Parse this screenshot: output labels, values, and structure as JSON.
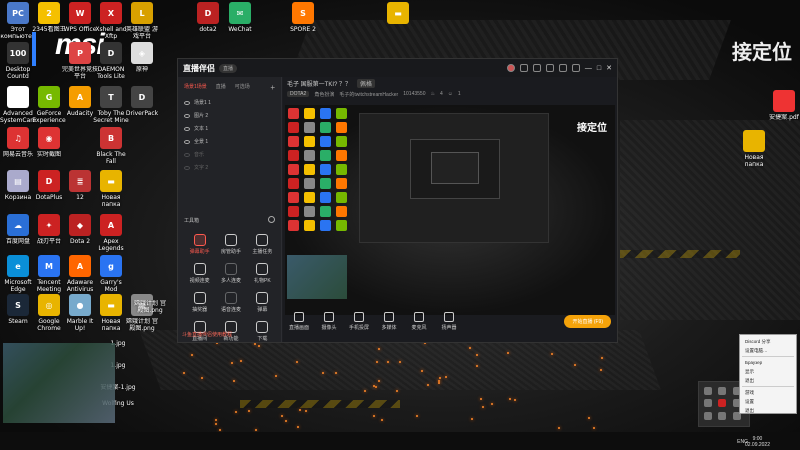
{
  "desktop": {
    "brand": "msi",
    "watermark": "接定位",
    "icons": [
      {
        "label": "Этот компьютер",
        "color": "#4a78c8",
        "glyph": "PC",
        "col": 0,
        "row": 0
      },
      {
        "label": "Desktop Countd",
        "color": "#333",
        "glyph": "100",
        "col": 0,
        "row": 1
      },
      {
        "label": "Advanced SystemCare",
        "color": "#fff",
        "glyph": "≡",
        "col": 0,
        "row": 2
      },
      {
        "label": "网易云音乐",
        "color": "#d33",
        "glyph": "♫",
        "col": 0,
        "row": 3
      },
      {
        "label": "Корзина",
        "color": "#aac",
        "glyph": "▤",
        "col": 0,
        "row": 4
      },
      {
        "label": "百度网盘",
        "color": "#2a6fd6",
        "glyph": "☁",
        "col": 0,
        "row": 5
      },
      {
        "label": "Microsoft Edge",
        "color": "#0a8fd8",
        "glyph": "e",
        "col": 0,
        "row": 6
      },
      {
        "label": "Steam",
        "color": "#1b2838",
        "glyph": "S",
        "col": 0,
        "row": 7
      },
      {
        "label": "2345看图王",
        "color": "#f5c000",
        "glyph": "2",
        "col": 1,
        "row": 0
      },
      {
        "label": "GeForce Experience",
        "color": "#76b900",
        "glyph": "G",
        "col": 1,
        "row": 2
      },
      {
        "label": "实时截图",
        "color": "#d33",
        "glyph": "◉",
        "col": 1,
        "row": 3
      },
      {
        "label": "DotaPlus",
        "color": "#c22",
        "glyph": "D",
        "col": 1,
        "row": 4
      },
      {
        "label": "战刃平台",
        "color": "#c22",
        "glyph": "✦",
        "col": 1,
        "row": 5
      },
      {
        "label": "Tencent Meeting",
        "color": "#2a74f2",
        "glyph": "M",
        "col": 1,
        "row": 6
      },
      {
        "label": "Google Chrome",
        "color": "#e8b400",
        "glyph": "◎",
        "col": 1,
        "row": 7
      },
      {
        "label": "WPS Office",
        "color": "#c22",
        "glyph": "W",
        "col": 2,
        "row": 0
      },
      {
        "label": "完美世界竞技平台",
        "color": "#d44",
        "glyph": "P",
        "col": 2,
        "row": 1
      },
      {
        "label": "Audacity",
        "color": "#f59d00",
        "glyph": "A",
        "col": 2,
        "row": 2
      },
      {
        "label": "12",
        "color": "#b33",
        "glyph": "≣",
        "col": 2,
        "row": 4
      },
      {
        "label": "Dota 2",
        "color": "#b22",
        "glyph": "◆",
        "col": 2,
        "row": 5
      },
      {
        "label": "Adaware Antivirus",
        "color": "#f60",
        "glyph": "A",
        "col": 2,
        "row": 6
      },
      {
        "label": "Marble It Up!",
        "color": "#7ac",
        "glyph": "●",
        "col": 2,
        "row": 7
      },
      {
        "label": "Xshell and Xftp",
        "color": "#c22",
        "glyph": "X",
        "col": 3,
        "row": 0
      },
      {
        "label": "DAEMON Tools Lite",
        "color": "#333",
        "glyph": "D",
        "col": 3,
        "row": 1
      },
      {
        "label": "Toby The Secret Mine",
        "color": "#444",
        "glyph": "T",
        "col": 3,
        "row": 2
      },
      {
        "label": "Black The Fall",
        "color": "#c33",
        "glyph": "B",
        "col": 3,
        "row": 3
      },
      {
        "label": "Новая папка",
        "color": "#e8b400",
        "glyph": "▬",
        "col": 3,
        "row": 4
      },
      {
        "label": "Apex Legends",
        "color": "#c22",
        "glyph": "A",
        "col": 3,
        "row": 5
      },
      {
        "label": "Garry's Mod",
        "color": "#2a74f2",
        "glyph": "g",
        "col": 3,
        "row": 6
      },
      {
        "label": "Новая папка",
        "color": "#e8b400",
        "glyph": "▬",
        "col": 3,
        "row": 7
      },
      {
        "label": "英雄联盟 游戏平台",
        "color": "#d8a000",
        "glyph": "L",
        "col": 4,
        "row": 0
      },
      {
        "label": "原神",
        "color": "#ddd",
        "glyph": "◈",
        "col": 4,
        "row": 1
      },
      {
        "label": "DriverPack",
        "color": "#444",
        "glyph": "D",
        "col": 4,
        "row": 2
      },
      {
        "label": "嫦娥计划 宫殿图.png",
        "color": "#888",
        "glyph": "▦",
        "col": 4,
        "row": 7
      }
    ],
    "top_icons": [
      {
        "label": "dota2",
        "color": "#b22",
        "glyph": "D"
      },
      {
        "label": "WeChat",
        "color": "#2aae67",
        "glyph": "✉"
      },
      {
        "label": "SPORE 2",
        "color": "#f70",
        "glyph": "S"
      },
      {
        "label": "",
        "color": "#e8b400",
        "glyph": "▬"
      }
    ],
    "right_files": [
      {
        "label": "安捷案.pdf",
        "color": "#e33"
      },
      {
        "label": "Новая папка",
        "color": "#e8b400"
      }
    ],
    "bottom_files": [
      "1.jpg",
      "1.jpg",
      "安捷案-1.jpg",
      "嫦娥计划 宫殿图.png",
      "Wolfing Us"
    ]
  },
  "app": {
    "logo": "直播伴侣",
    "version_pill": "直播",
    "room_title": "毛子 国服第一TKI? ？？",
    "room_tag": "佩格",
    "game_tag": "DOTA2",
    "category_tag": "角色扮演",
    "streamer": "毛子的twitchstreamHacker",
    "room_id": "10143550",
    "stats": [
      "4",
      "1"
    ],
    "sidebar_tabs": [
      "场景1场景",
      "直播",
      "可选场"
    ],
    "scenes": [
      {
        "label": "场景1 1"
      },
      {
        "label": "图片 2"
      },
      {
        "label": "文本 1"
      },
      {
        "label": "全景 1"
      },
      {
        "label": "音乐"
      },
      {
        "label": "文字 2"
      }
    ],
    "toolbox_label": "工具箱",
    "tools": [
      {
        "label": "弹幕助手",
        "state": "red"
      },
      {
        "label": "房管助手",
        "state": "normal"
      },
      {
        "label": "主播任务",
        "state": "normal"
      },
      {
        "label": "视频连麦",
        "state": "normal"
      },
      {
        "label": "多人连麦",
        "state": "dim"
      },
      {
        "label": "礼物PK",
        "state": "normal"
      },
      {
        "label": "抽奖器",
        "state": "normal"
      },
      {
        "label": "语音连麦",
        "state": "dim"
      },
      {
        "label": "弹幕",
        "state": "normal"
      },
      {
        "label": "直播间",
        "state": "normal"
      },
      {
        "label": "新功能",
        "state": "normal"
      },
      {
        "label": "下载",
        "state": "normal"
      }
    ],
    "notice": "斗鱼直播伴侣使用教程",
    "bottom_buttons": [
      "直播画面",
      "摄像头",
      "手机投屏",
      "多媒体",
      "麦克风",
      "扬声器"
    ],
    "golive": "开始直播 (F9)"
  },
  "tray_menu": {
    "items": [
      "Discord  分享",
      "设置电脑…",
      "Браузер",
      "显示",
      "退出",
      "游戏",
      "设置",
      "退出"
    ]
  },
  "taskbar": {
    "lang": "ENG",
    "time": "9:00",
    "date": "02.09.2022"
  }
}
